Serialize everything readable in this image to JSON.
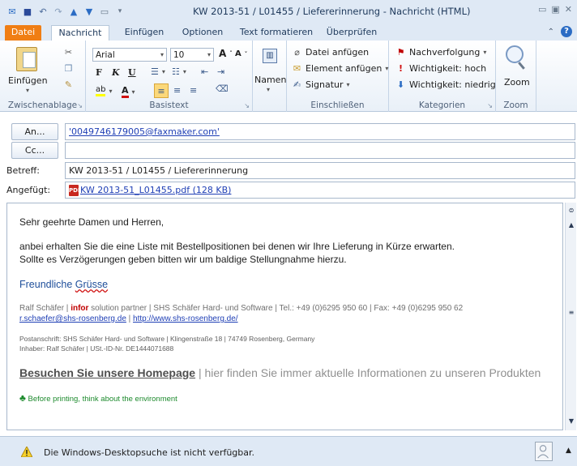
{
  "window": {
    "title": "KW 2013-51 / L01455 / Liefererinnerung  -  Nachricht (HTML)"
  },
  "tabs": [
    "Datei",
    "Nachricht",
    "Einfügen",
    "Optionen",
    "Text formatieren",
    "Überprüfen"
  ],
  "ribbon": {
    "clipboard": {
      "paste": "Einfügen",
      "label": "Zwischenablage"
    },
    "basictext": {
      "font": "Arial",
      "size": "10",
      "label": "Basistext",
      "bold": "F",
      "italic": "K",
      "underline": "U"
    },
    "names": {
      "label": "Namen"
    },
    "include": {
      "attach_file": "Datei anfügen",
      "attach_item": "Element anfügen",
      "signature": "Signatur",
      "label": "Einschließen"
    },
    "tags": {
      "follow_up": "Nachverfolgung",
      "high": "Wichtigkeit: hoch",
      "low": "Wichtigkeit: niedrig",
      "label": "Kategorien"
    },
    "zoom": {
      "button": "Zoom",
      "label": "Zoom"
    }
  },
  "header": {
    "to_button": "An...",
    "to_value": "'0049746179005@faxmaker.com'",
    "cc_button": "Cc...",
    "cc_value": "",
    "subject_label": "Betreff:",
    "subject_value": "KW 2013-51 / L01455 / Liefererinnerung",
    "attached_label": "Angefügt:",
    "attachment": "KW 2013-51_L01455.pdf (128 KB)"
  },
  "body": {
    "salutation": "Sehr geehrte Damen und Herren,",
    "line1": "anbei erhalten Sie die eine Liste mit Bestellpositionen bei denen wir Ihre Lieferung in Kürze erwarten.",
    "line2": "Sollte es Verzögerungen geben bitten wir um baldige Stellungnahme hierzu.",
    "greeting_a": "Freundliche ",
    "greeting_b": "Grüsse",
    "sig_name": "Ralf Schäfer | ",
    "sig_infor": "infor",
    "sig_rest": " solution partner | SHS Schäfer Hard- und Software | Tel.: +49 (0)6295 950 60 | Fax: +49 (0)6295 950 62",
    "email": "r.schaefer@shs-rosenberg.de",
    "sep": " | ",
    "website": "http://www.shs-rosenberg.de/",
    "postal": "Postanschrift: SHS Schäfer Hard- und Software | Klingenstraße 18 | 74749 Rosenberg, Germany",
    "owner": "Inhaber: Ralf Schäfer  | USt.-ID-Nr. DE1444071688",
    "homepage_link": "Besuchen Sie unsere Homepage",
    "homepage_rest": " | hier finden Sie immer aktuelle Informationen zu unseren Produkten",
    "eco": "Before printing, think about the environment"
  },
  "status": {
    "warning": "Die Windows-Desktopsuche ist nicht verfügbar."
  },
  "colors": {
    "file_tab": "#f07e14",
    "link": "#1f3fb5",
    "infor": "#c00000",
    "eco": "#1d8a2d"
  }
}
